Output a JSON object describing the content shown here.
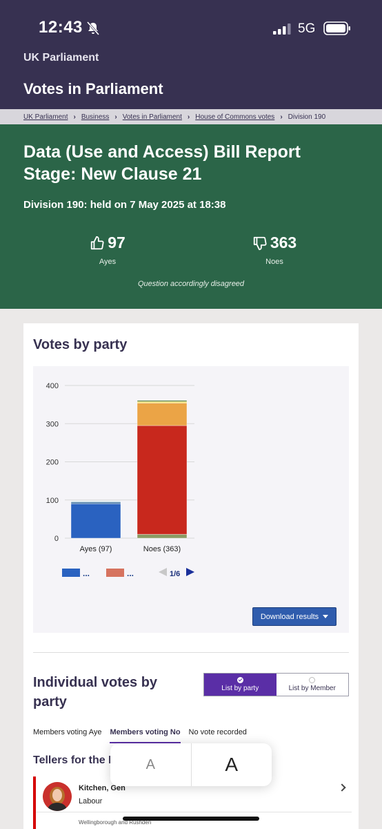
{
  "status": {
    "time": "12:43",
    "network": "5G"
  },
  "header": {
    "brand": "UK Parliament",
    "title": "Votes in Parliament"
  },
  "breadcrumb": [
    "UK Parliament",
    "Business",
    "Votes in Parliament",
    "House of Commons votes",
    "Division 190"
  ],
  "hero": {
    "title": "Data (Use and Access) Bill Report Stage: New Clause 21",
    "subtitle": "Division 190: held on 7 May 2025 at 18:38",
    "ayes_count": "97",
    "ayes_label": "Ayes",
    "noes_count": "363",
    "noes_label": "Noes",
    "outcome": "Question accordingly disagreed"
  },
  "chart_section": {
    "title": "Votes by party",
    "download_label": "Download results"
  },
  "chart_data": {
    "type": "bar",
    "stacked": true,
    "categories": [
      "Ayes (97)",
      "Noes (363)"
    ],
    "ylim": [
      0,
      400
    ],
    "yticks": [
      0,
      100,
      200,
      300,
      400
    ],
    "grid": true,
    "series": [
      {
        "values": [
          0,
          10
        ],
        "color": "#8a9a62"
      },
      {
        "values": [
          0,
          285
        ],
        "color": "#c8281d"
      },
      {
        "values": [
          0,
          59
        ],
        "color": "#eba446"
      },
      {
        "values": [
          0,
          4
        ],
        "color": "#f2de6a"
      },
      {
        "values": [
          0,
          3
        ],
        "color": "#4f7a3a"
      },
      {
        "values": [
          0,
          2
        ],
        "color": "#e8e8e8"
      },
      {
        "values": [
          90,
          0
        ],
        "color": "#2a62c0"
      },
      {
        "values": [
          5,
          0
        ],
        "color": "#5e8ab0"
      },
      {
        "values": [
          2,
          0
        ],
        "color": "#b8d8e0"
      }
    ],
    "legend": [
      {
        "label": "...",
        "color": "#2a62c0"
      },
      {
        "label": "...",
        "color": "#d6735f"
      }
    ],
    "legend_page": "1/6"
  },
  "individual": {
    "title": "Individual votes by party",
    "toggle_party": "List by party",
    "toggle_member": "List by Member",
    "tabs": [
      "Members voting Aye",
      "Members voting No",
      "No vote recorded"
    ],
    "tellers_title": "Tellers for the Noes",
    "member": {
      "name": "Kitchen, Gen",
      "party": "Labour",
      "constituency": "Wellingborough and Rushden",
      "party_color": "#d50000"
    }
  },
  "font_popup": {
    "small": "A",
    "large": "A"
  }
}
